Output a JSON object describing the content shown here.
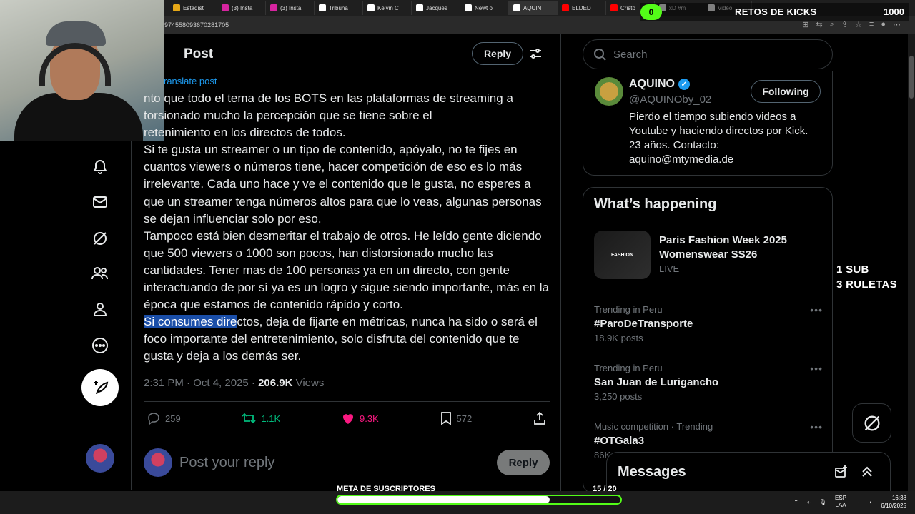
{
  "browser": {
    "tabs": [
      {
        "label": "Estadíst",
        "color": "#e6a817"
      },
      {
        "label": "(3) Insta",
        "color": "#d6249f"
      },
      {
        "label": "(3) Insta",
        "color": "#d6249f"
      },
      {
        "label": "Tribuna",
        "color": "#ffffff"
      },
      {
        "label": "Kelvin C",
        "color": "#ffffff"
      },
      {
        "label": "Jacques",
        "color": "#ffffff"
      },
      {
        "label": "Newt o",
        "color": "#ffffff"
      },
      {
        "label": "AQUIN",
        "color": "#ffffff"
      },
      {
        "label": "ELDED",
        "color": "#ff0000"
      },
      {
        "label": "Cristo",
        "color": "#ff0000"
      },
      {
        "label": "xD #m",
        "color": "#ffffff"
      },
      {
        "label": "Video",
        "color": "#ffffff"
      }
    ],
    "url": "974558093670281705"
  },
  "nav": {
    "items": [
      {
        "name": "notifications",
        "icon": "bell-icon"
      },
      {
        "name": "messages",
        "icon": "mail-icon"
      },
      {
        "name": "grok",
        "icon": "grok-icon"
      },
      {
        "name": "communities",
        "icon": "people-icon"
      },
      {
        "name": "profile",
        "icon": "person-icon"
      },
      {
        "name": "more",
        "icon": "more-icon"
      }
    ]
  },
  "post": {
    "header": "Post",
    "reply_label": "Reply",
    "translate": "ranslate post",
    "paragraphs": [
      "nto que todo el tema de los BOTS en las plataformas de streaming a",
      "torsionado mucho la percepción que se tiene sobre el",
      "retenimiento en los directos de todos.",
      "Si te gusta un streamer o un tipo de contenido, apóyalo, no te fijes en cuantos viewers o números tiene, hacer competición de eso es lo más irrelevante. Cada uno hace y ve el contenido que le gusta, no esperes a que un streamer tenga números altos para que lo veas, algunas personas se dejan influenciar solo por eso.",
      "Tampoco está bien desmeritar el trabajo de otros. He leído gente diciendo que 500 viewers o 1000 son pocos, han distorsionado mucho las cantidades. Tener mas de 100 personas ya en un directo, con gente interactuando de por sí ya es un logro y sigue siendo importante, más en la época que estamos de contenido rápido y corto."
    ],
    "last_highlight": "Si consumes dire",
    "last_rest": "ctos, deja de fijarte en métricas, nunca ha sido o será el foco importante del entretenimiento, solo disfruta del contenido que te gusta y deja a los demás ser.",
    "time": "2:31 PM · Oct 4, 2025 · ",
    "views_count": "206.9K",
    "views_label": " Views",
    "replies": "259",
    "reposts": "1.1K",
    "likes": "9.3K",
    "bookmarks": "572",
    "reply_placeholder": "Post your reply",
    "reply_button": "Reply"
  },
  "sidebar": {
    "search_placeholder": "Search",
    "profile": {
      "name": "AQUINO",
      "handle": "@AQUINOby_02",
      "follow": "Following",
      "bio": "Pierdo el tiempo subiendo videos a Youtube y haciendo directos por Kick. 23 años. Contacto: aquino@mtymedia.de"
    },
    "happening_title": "What’s happening",
    "event": {
      "thumb": "FASHION",
      "title": "Paris Fashion Week 2025 Womenswear SS26",
      "status": "LIVE"
    },
    "trends": [
      {
        "context": "Trending in Peru",
        "name": "#ParoDeTransporte",
        "posts": "18.9K posts"
      },
      {
        "context": "Trending in Peru",
        "name": "San Juan de Lurigancho",
        "posts": "3,250 posts"
      },
      {
        "context": "Music competition · Trending",
        "name": "#OTGala3",
        "posts": "86K"
      }
    ],
    "messages_title": "Messages"
  },
  "overlay": {
    "retos_badge": "0",
    "retos_label": "RETOS DE KICKS",
    "retos_count": "1000",
    "rules_line1": "1 SUB",
    "rules_line2": "3 RULETAS",
    "meta_label": "META DE SUSCRIPTORES",
    "meta_count": "15 / 20",
    "meta_progress": 0.75
  },
  "taskbar": {
    "lang1": "ESP",
    "lang2": "LAA",
    "time": "16:38",
    "date": "6/10/2025"
  },
  "colors": {
    "accent": "#1d9bf0",
    "repost": "#00ba7c",
    "like": "#f91880",
    "kick": "#53fc18"
  }
}
